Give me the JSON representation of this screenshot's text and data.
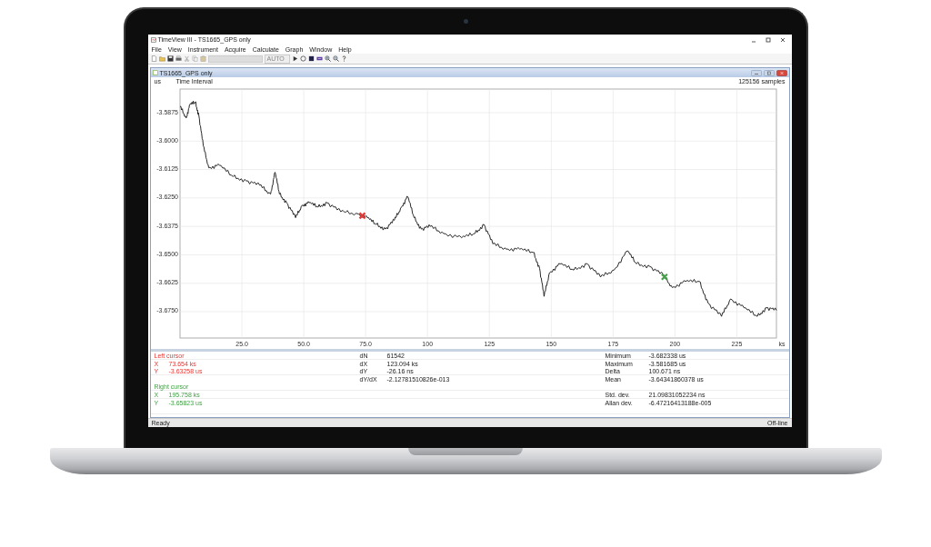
{
  "window": {
    "title": "TimeView III - TS1665_GPS only"
  },
  "menu": [
    "File",
    "View",
    "Instrument",
    "Acquire",
    "Calculate",
    "Graph",
    "Window",
    "Help"
  ],
  "toolbar": {
    "auto_label": "AUTO"
  },
  "document": {
    "title": "TS1665_GPS only",
    "samples": "125156 samples",
    "chart_data": {
      "type": "line",
      "grid": true,
      "xlabel": "ks",
      "ylabel": "us",
      "xlim": [
        0,
        241
      ],
      "ylim": [
        -3.6866,
        -3.5771
      ],
      "x": [
        0,
        2.5,
        4,
        6.2,
        7.6,
        9.4,
        11.6,
        15.9,
        21.4,
        26.8,
        32.2,
        36.6,
        38.4,
        40.2,
        43.1,
        46.7,
        49.3,
        52.2,
        55.8,
        59.4,
        64.9,
        72.1,
        75.7,
        79.3,
        83,
        86.6,
        89.5,
        92,
        94.6,
        97.5,
        101.1,
        106.5,
        113.8,
        119.2,
        122.8,
        126.4,
        131.9,
        137.3,
        142.8,
        145.3,
        147.1,
        149.3,
        153.6,
        159.1,
        164.5,
        169.9,
        175.4,
        180.8,
        184.4,
        189.9,
        195.3,
        198.9,
        204.3,
        209.8,
        213.4,
        218.8,
        222.5,
        227.9,
        233.3,
        237,
        241
      ],
      "series": [
        {
          "name": "Time Interval",
          "color": "#111111",
          "values": [
            -3.5848,
            -3.5898,
            -3.584,
            -3.5829,
            -3.5887,
            -3.6021,
            -3.6117,
            -3.6106,
            -3.6156,
            -3.6175,
            -3.6194,
            -3.6233,
            -3.6137,
            -3.6233,
            -3.6271,
            -3.6337,
            -3.6283,
            -3.6271,
            -3.629,
            -3.6271,
            -3.631,
            -3.6321,
            -3.6337,
            -3.6367,
            -3.6387,
            -3.6348,
            -3.629,
            -3.6244,
            -3.6337,
            -3.6387,
            -3.6375,
            -3.6406,
            -3.6425,
            -3.6406,
            -3.6367,
            -3.6452,
            -3.6475,
            -3.6475,
            -3.649,
            -3.656,
            -3.6683,
            -3.6579,
            -3.654,
            -3.6567,
            -3.654,
            -3.6598,
            -3.6567,
            -3.6483,
            -3.654,
            -3.6552,
            -3.659,
            -3.6644,
            -3.6617,
            -3.6617,
            -3.6713,
            -3.6771,
            -3.6694,
            -3.6733,
            -3.6771,
            -3.6733,
            -3.6744
          ]
        }
      ],
      "xticks": [
        {
          "value": 25,
          "label": "25.0"
        },
        {
          "value": 50,
          "label": "50.0"
        },
        {
          "value": 75,
          "label": "75.0"
        },
        {
          "value": 100,
          "label": "100"
        },
        {
          "value": 125,
          "label": "125"
        },
        {
          "value": 150,
          "label": "150"
        },
        {
          "value": 175,
          "label": "175"
        },
        {
          "value": 200,
          "label": "200"
        },
        {
          "value": 225,
          "label": "225"
        }
      ],
      "yticks": [
        {
          "value": -3.5875,
          "label": "-3.5875"
        },
        {
          "value": -3.6,
          "label": "-3.6000"
        },
        {
          "value": -3.6125,
          "label": "-3.6125"
        },
        {
          "value": -3.625,
          "label": "-3.6250"
        },
        {
          "value": -3.6375,
          "label": "-3.6375"
        },
        {
          "value": -3.65,
          "label": "-3.6500"
        },
        {
          "value": -3.6625,
          "label": "-3.6625"
        },
        {
          "value": -3.675,
          "label": "-3.6750"
        }
      ]
    }
  },
  "cursors": [
    {
      "title": "Left cursor",
      "color": "#e53935",
      "rows": [
        {
          "label": "X",
          "value": "73.654 ks"
        },
        {
          "label": "Y",
          "value": "-3.63258 us"
        }
      ]
    },
    {
      "title": "Right cursor",
      "color": "#43a047",
      "rows": [
        {
          "label": "X",
          "value": "195.758 ks"
        },
        {
          "label": "Y",
          "value": "-3.65823 us"
        }
      ]
    }
  ],
  "deltas": [
    {
      "label": "dN",
      "value": "61542"
    },
    {
      "label": "dX",
      "value": "123.094 ks"
    },
    {
      "label": "dY",
      "value": "-26.16 ns"
    },
    {
      "label": "dY/dX",
      "value": "-2.12781510826e-013"
    }
  ],
  "stats": [
    {
      "label": "Minimum",
      "value": "-3.682338 us"
    },
    {
      "label": "Maximum",
      "value": "-3.581685 us"
    },
    {
      "label": "Delta",
      "value": "100.671 ns"
    },
    {
      "label": "Mean",
      "value": "-3.64341860378 us"
    }
  ],
  "stats_2": [
    {
      "label": "Std. dev.",
      "value": "21.09831052234 ns"
    },
    {
      "label": "Allan dev.",
      "value": "-6.47216413188e-005"
    }
  ],
  "status_bar": {
    "left": "Ready",
    "right": "Off-line"
  }
}
